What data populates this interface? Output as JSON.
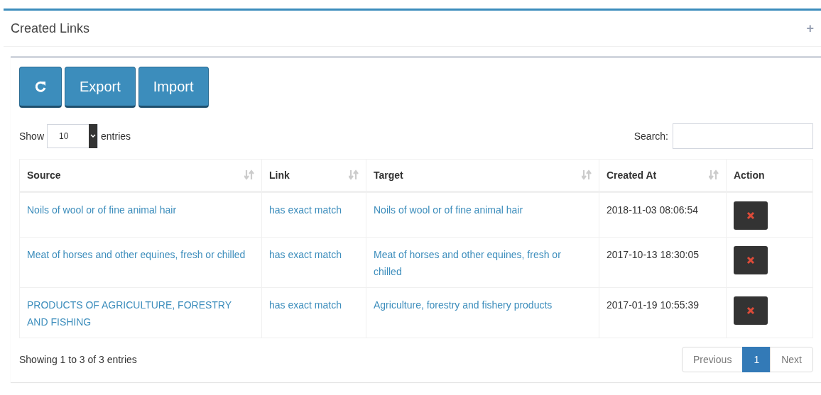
{
  "panel": {
    "title": "Created Links",
    "expand_icon": "+"
  },
  "toolbar": {
    "buttons": [
      {
        "kind": "refresh"
      },
      {
        "kind": "text",
        "label": "Export"
      },
      {
        "kind": "text",
        "label": "Import"
      }
    ]
  },
  "length_menu": {
    "prefix": "Show",
    "value": "10",
    "suffix": "entries"
  },
  "search": {
    "label": "Search:"
  },
  "table": {
    "columns": [
      {
        "label": "Source",
        "sortable": true
      },
      {
        "label": "Link",
        "sortable": true
      },
      {
        "label": "Target",
        "sortable": true
      },
      {
        "label": "Created At",
        "sortable": true
      },
      {
        "label": "Action",
        "sortable": false
      }
    ],
    "rows": [
      {
        "source": "Noils of wool or of fine animal hair",
        "link": "has exact match",
        "target": "Noils of wool or of fine animal hair",
        "created_at": "2018-11-03 08:06:54"
      },
      {
        "source": "Meat of horses and other equines, fresh or chilled",
        "link": "has exact match",
        "target": "Meat of horses and other equines, fresh or chilled",
        "created_at": "2017-10-13 18:30:05"
      },
      {
        "source": "PRODUCTS OF AGRICULTURE, FORESTRY AND FISHING",
        "link": "has exact match",
        "target": "Agriculture, forestry and fishery products",
        "created_at": "2017-01-19 10:55:39"
      }
    ]
  },
  "info": "Showing 1 to 3 of 3 entries",
  "pagination": [
    {
      "label": "Previous",
      "selected": false
    },
    {
      "label": "1",
      "selected": true
    },
    {
      "label": "Next",
      "selected": false
    }
  ]
}
